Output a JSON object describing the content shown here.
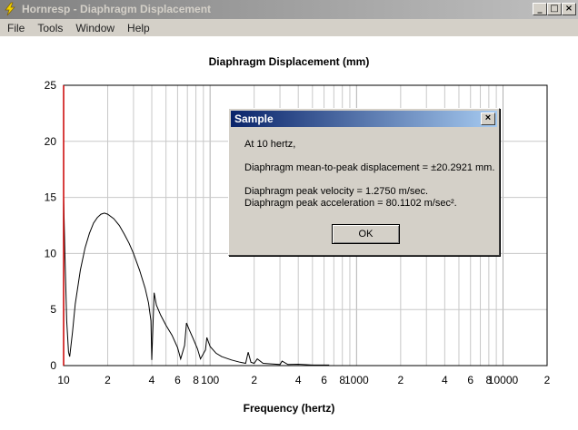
{
  "window": {
    "title": "Hornresp - Diaphragm Displacement",
    "controls": {
      "minimize": "_",
      "maximize": "□",
      "close": "×"
    }
  },
  "menu": [
    "File",
    "Tools",
    "Window",
    "Help"
  ],
  "chart_data": {
    "type": "line",
    "title": "Diaphragm Displacement (mm)",
    "xlabel": "Frequency (hertz)",
    "ylabel": "",
    "x_scale": "log",
    "xlim": [
      10,
      20000
    ],
    "ylim": [
      0,
      25
    ],
    "grid": true,
    "x_tick_labels": [
      {
        "value": 10,
        "label": "10"
      },
      {
        "value": 20,
        "label": "2"
      },
      {
        "value": 40,
        "label": "4"
      },
      {
        "value": 60,
        "label": "6"
      },
      {
        "value": 80,
        "label": "8"
      },
      {
        "value": 100,
        "label": "100"
      },
      {
        "value": 200,
        "label": "2"
      },
      {
        "value": 400,
        "label": "4"
      },
      {
        "value": 600,
        "label": "6"
      },
      {
        "value": 800,
        "label": "8"
      },
      {
        "value": 1000,
        "label": "1000"
      },
      {
        "value": 2000,
        "label": "2"
      },
      {
        "value": 4000,
        "label": "4"
      },
      {
        "value": 6000,
        "label": "6"
      },
      {
        "value": 8000,
        "label": "8"
      },
      {
        "value": 10000,
        "label": "10000"
      },
      {
        "value": 20000,
        "label": "2"
      }
    ],
    "y_ticks": [
      0,
      5,
      10,
      15,
      20,
      25
    ],
    "series": [
      {
        "color": "#000000",
        "points": [
          [
            10,
            15.0
          ],
          [
            10.2,
            10.0
          ],
          [
            10.5,
            4.0
          ],
          [
            10.8,
            1.2
          ],
          [
            11.0,
            0.8
          ],
          [
            11.5,
            3.0
          ],
          [
            12,
            5.5
          ],
          [
            13,
            8.5
          ],
          [
            14,
            10.5
          ],
          [
            15,
            11.8
          ],
          [
            16,
            12.7
          ],
          [
            17,
            13.2
          ],
          [
            18,
            13.5
          ],
          [
            19,
            13.6
          ],
          [
            20,
            13.5
          ],
          [
            22,
            13.1
          ],
          [
            24,
            12.5
          ],
          [
            26,
            11.7
          ],
          [
            28,
            10.9
          ],
          [
            30,
            10.0
          ],
          [
            33,
            8.5
          ],
          [
            36,
            6.9
          ],
          [
            38,
            5.6
          ],
          [
            39.5,
            4.0
          ],
          [
            40,
            0.5
          ],
          [
            41.5,
            6.5
          ],
          [
            43,
            5.4
          ],
          [
            46,
            4.5
          ],
          [
            50,
            3.6
          ],
          [
            55,
            2.7
          ],
          [
            60,
            1.6
          ],
          [
            63,
            0.6
          ],
          [
            67,
            1.8
          ],
          [
            69,
            3.8
          ],
          [
            72,
            3.2
          ],
          [
            76,
            2.5
          ],
          [
            82,
            1.5
          ],
          [
            86,
            0.6
          ],
          [
            93,
            1.4
          ],
          [
            95,
            2.5
          ],
          [
            100,
            1.7
          ],
          [
            110,
            1.1
          ],
          [
            120,
            0.8
          ],
          [
            140,
            0.5
          ],
          [
            160,
            0.3
          ],
          [
            175,
            0.2
          ],
          [
            182,
            1.2
          ],
          [
            190,
            0.3
          ],
          [
            200,
            0.2
          ],
          [
            210,
            0.6
          ],
          [
            230,
            0.2
          ],
          [
            260,
            0.15
          ],
          [
            300,
            0.1
          ],
          [
            310,
            0.4
          ],
          [
            340,
            0.1
          ],
          [
            400,
            0.12
          ],
          [
            500,
            0.05
          ],
          [
            650,
            0.05
          ]
        ]
      },
      {
        "color": "#cc0000",
        "points": [
          [
            10,
            0
          ],
          [
            10,
            25
          ]
        ]
      }
    ]
  },
  "dialog": {
    "title": "Sample",
    "close": "×",
    "lines": [
      "At 10 hertz,",
      "Diaphragm mean-to-peak displacement = ±20.2921 mm.",
      "Diaphragm peak velocity = 1.2750 m/sec.",
      "Diaphragm peak acceleration = 80.1102 m/sec²."
    ],
    "ok_label": "OK"
  },
  "colors": {
    "plot_line": "#000000",
    "axis_marker": "#cc0000",
    "grid": "#c8c8c8",
    "dialog_title_start": "#0a246a",
    "dialog_title_end": "#a6caf0"
  }
}
